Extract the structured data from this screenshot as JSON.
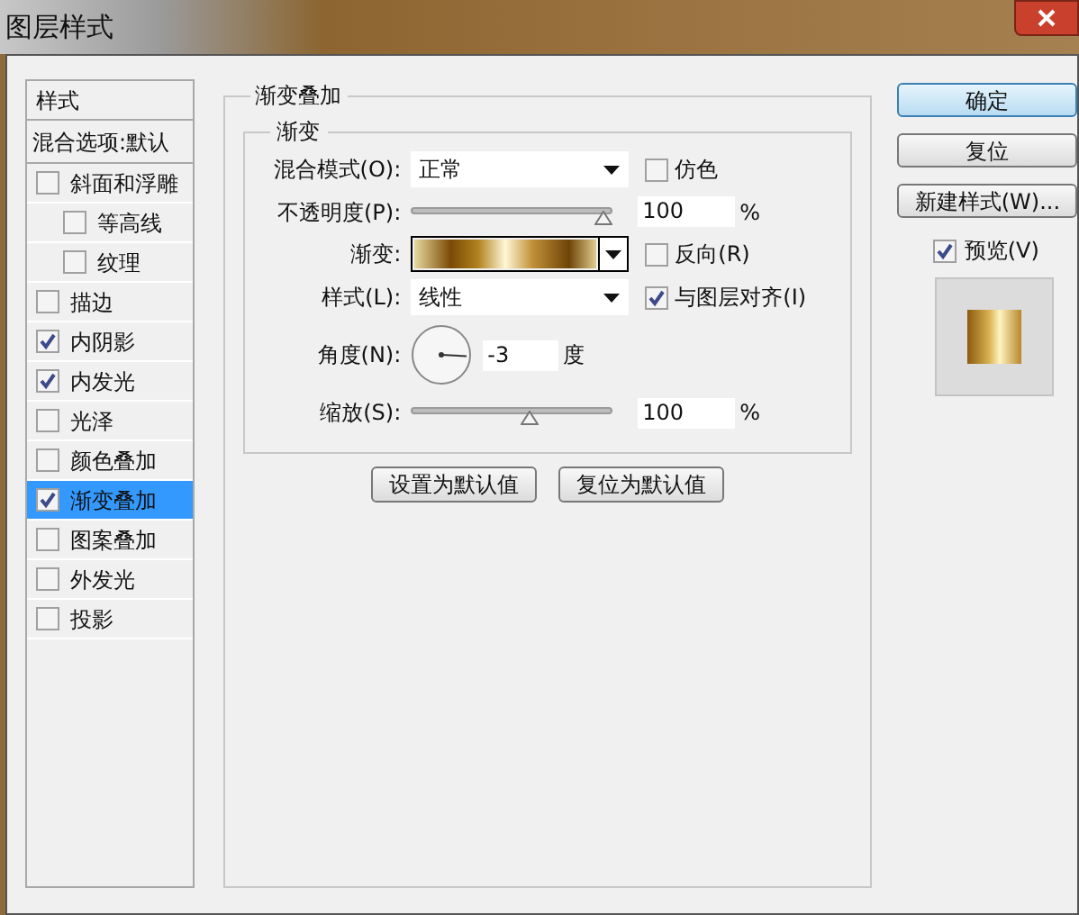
{
  "window": {
    "title": "图层样式"
  },
  "styles_list": {
    "header": "样式",
    "blending_options": "混合选项:默认",
    "items": [
      {
        "label": "斜面和浮雕",
        "checked": false,
        "selected": false,
        "children": [
          {
            "label": "等高线",
            "checked": false,
            "selected": false
          },
          {
            "label": "纹理",
            "checked": false,
            "selected": false
          }
        ]
      },
      {
        "label": "描边",
        "checked": false,
        "selected": false
      },
      {
        "label": "内阴影",
        "checked": true,
        "selected": false
      },
      {
        "label": "内发光",
        "checked": true,
        "selected": false
      },
      {
        "label": "光泽",
        "checked": false,
        "selected": false
      },
      {
        "label": "颜色叠加",
        "checked": false,
        "selected": false
      },
      {
        "label": "渐变叠加",
        "checked": true,
        "selected": true
      },
      {
        "label": "图案叠加",
        "checked": false,
        "selected": false
      },
      {
        "label": "外发光",
        "checked": false,
        "selected": false
      },
      {
        "label": "投影",
        "checked": false,
        "selected": false
      }
    ]
  },
  "gradient_overlay": {
    "title": "渐变叠加",
    "group_title": "渐变",
    "blend_mode": {
      "label": "混合模式(O):",
      "value": "正常"
    },
    "dither": {
      "label": "仿色",
      "checked": false
    },
    "opacity": {
      "label": "不透明度(P):",
      "level": 1,
      "value": "100",
      "unit": "%"
    },
    "gradient": {
      "label": "渐变:"
    },
    "reverse": {
      "label": "反向(R)",
      "checked": false
    },
    "style": {
      "label": "样式(L):",
      "value": "线性"
    },
    "align_with_layer": {
      "label": "与图层对齐(I)",
      "checked": true
    },
    "angle": {
      "label": "角度(N):",
      "value": "-3",
      "unit": "度"
    },
    "scale": {
      "label": "缩放(S):",
      "level": 0.6,
      "value": "100",
      "unit": "%"
    },
    "buttons": [
      "设置为默认值",
      "复位为默认值"
    ]
  },
  "actions": {
    "buttons": [
      {
        "label": "确定",
        "selected": true
      },
      {
        "label": "复位",
        "selected": false
      },
      {
        "label": "新建样式(W)...",
        "selected": false
      }
    ],
    "preview": {
      "label": "预览(V)",
      "checked": true
    }
  }
}
